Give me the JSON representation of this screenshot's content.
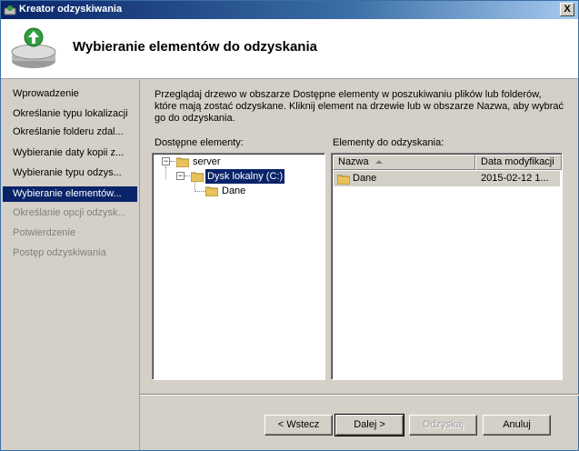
{
  "window": {
    "title": "Kreator odzyskiwania",
    "close_label": "X"
  },
  "header": {
    "heading": "Wybieranie elementów do odzyskania",
    "icon": "backup-restore-icon"
  },
  "sidebar": {
    "steps": [
      {
        "label": "Wprowadzenie",
        "state": "normal"
      },
      {
        "label": "Określanie typu lokalizacji",
        "state": "normal"
      },
      {
        "label": "Określanie folderu zdal...",
        "state": "normal"
      },
      {
        "label": "Wybieranie daty kopii z...",
        "state": "normal"
      },
      {
        "label": "Wybieranie typu odzys...",
        "state": "normal"
      },
      {
        "label": "Wybieranie elementów...",
        "state": "active"
      },
      {
        "label": "Określanie opcji odzysk...",
        "state": "disabled"
      },
      {
        "label": "Potwierdzenie",
        "state": "disabled"
      },
      {
        "label": "Postęp odzyskiwania",
        "state": "disabled"
      }
    ]
  },
  "main": {
    "description": "Przeglądaj drzewo w obszarze Dostępne elementy w poszukiwaniu plików lub folderów, które mają zostać odzyskane. Kliknij element na drzewie lub w obszarze Nazwa, aby wybrać go do odzyskania.",
    "available_label": "Dostępne elementy:",
    "recover_label": "Elementy do odzyskania:",
    "tree": [
      {
        "label": "server",
        "expander": "−"
      },
      {
        "label": "Dysk lokalny (C:)",
        "expander": "−"
      },
      {
        "label": "Dane"
      }
    ],
    "list": {
      "columns": [
        "Nazwa",
        "Data modyfikacji"
      ],
      "rows": [
        {
          "name": "Dane",
          "modified": "2015-02-12 1..."
        }
      ]
    }
  },
  "buttons": {
    "back": "< Wstecz",
    "next": "Dalej >",
    "recover": "Odzyskaj",
    "cancel": "Anuluj"
  },
  "colors": {
    "selection": "#0a246a",
    "title_gradient_start": "#0a246a",
    "folder": "#e8c25a"
  }
}
